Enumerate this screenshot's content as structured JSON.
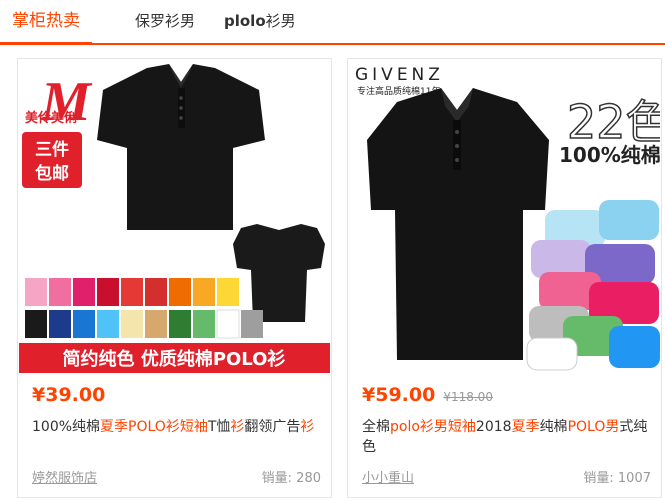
{
  "tabs": [
    {
      "label": "掌柜热卖"
    },
    {
      "label": "保罗衫男"
    },
    {
      "label_bold": "plolo",
      "label_rest": "衫男"
    }
  ],
  "products": [
    {
      "image": {
        "brand_mark": "M",
        "brand_text": "美伶美俐",
        "promo": "三件包邮",
        "banner": "简约纯色 优质纯棉POLO衫"
      },
      "price": "¥39.00",
      "title_parts": [
        {
          "t": "100%纯棉",
          "hl": false
        },
        {
          "t": "夏季",
          "hl": true
        },
        {
          "t": "POLO",
          "hl": true
        },
        {
          "t": "衫",
          "hl": true
        },
        {
          "t": "短袖",
          "hl": true
        },
        {
          "t": "T恤",
          "hl": false
        },
        {
          "t": "衫",
          "hl": true
        },
        {
          "t": "翻领广告",
          "hl": false
        },
        {
          "t": "衫",
          "hl": true
        }
      ],
      "shop": "婷然服饰店",
      "sales": "销量: 280"
    },
    {
      "image": {
        "brand": "GIVENZ",
        "brand_sub": "专注高品质纯棉11年",
        "colors": "22色",
        "cotton": "100%纯棉"
      },
      "price": "¥59.00",
      "original_price": "¥118.00",
      "title_parts": [
        {
          "t": "全棉",
          "hl": false
        },
        {
          "t": "polo",
          "hl": true
        },
        {
          "t": "衫",
          "hl": true
        },
        {
          "t": "男",
          "hl": true
        },
        {
          "t": "短袖",
          "hl": true
        },
        {
          "t": "2018",
          "hl": false
        },
        {
          "t": "夏季",
          "hl": true
        },
        {
          "t": "纯棉",
          "hl": false
        },
        {
          "t": "POLO",
          "hl": true
        },
        {
          "t": "男",
          "hl": true
        },
        {
          "t": "式纯色",
          "hl": false
        }
      ],
      "shop": "小小重山",
      "sales": "销量: 1007"
    }
  ]
}
